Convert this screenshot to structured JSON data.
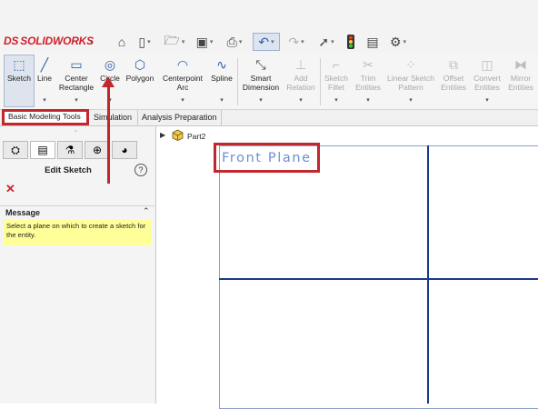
{
  "app": {
    "logo_prefix": "DS",
    "logo_text": "SOLIDWORKS"
  },
  "ribbon": {
    "sketch": "Sketch",
    "line": "Line",
    "center_rectangle": [
      "Center",
      "Rectangle"
    ],
    "circle": "Circle",
    "polygon": "Polygon",
    "centerpoint_arc": [
      "Centerpoint",
      "Arc"
    ],
    "spline": "Spline",
    "smart_dimension": [
      "Smart",
      "Dimension"
    ],
    "add_relation": [
      "Add",
      "Relation"
    ],
    "sketch_fillet": [
      "Sketch",
      "Fillet"
    ],
    "trim_entities": [
      "Trim",
      "Entities"
    ],
    "linear_sketch_pattern": [
      "Linear Sketch",
      "Pattern"
    ],
    "offset_entities": [
      "Offset",
      "Entities"
    ],
    "convert_entities": [
      "Convert",
      "Entities"
    ],
    "mirror_entities": [
      "Mirror",
      "Entities"
    ]
  },
  "tabs": [
    "Basic Modeling Tools",
    "Simulation",
    "Analysis Preparation"
  ],
  "panel": {
    "title": "Edit Sketch",
    "help": "?",
    "close": "✕",
    "message_title": "Message",
    "message_text": "Select a plane on which to create a sketch for the entity."
  },
  "tree": {
    "part": "Part2"
  },
  "viewport": {
    "plane_label": "Front Plane"
  },
  "colors": {
    "accent_red": "#c1272d",
    "axis_blue": "#1a3a8c",
    "message_bg": "#ffff99"
  }
}
